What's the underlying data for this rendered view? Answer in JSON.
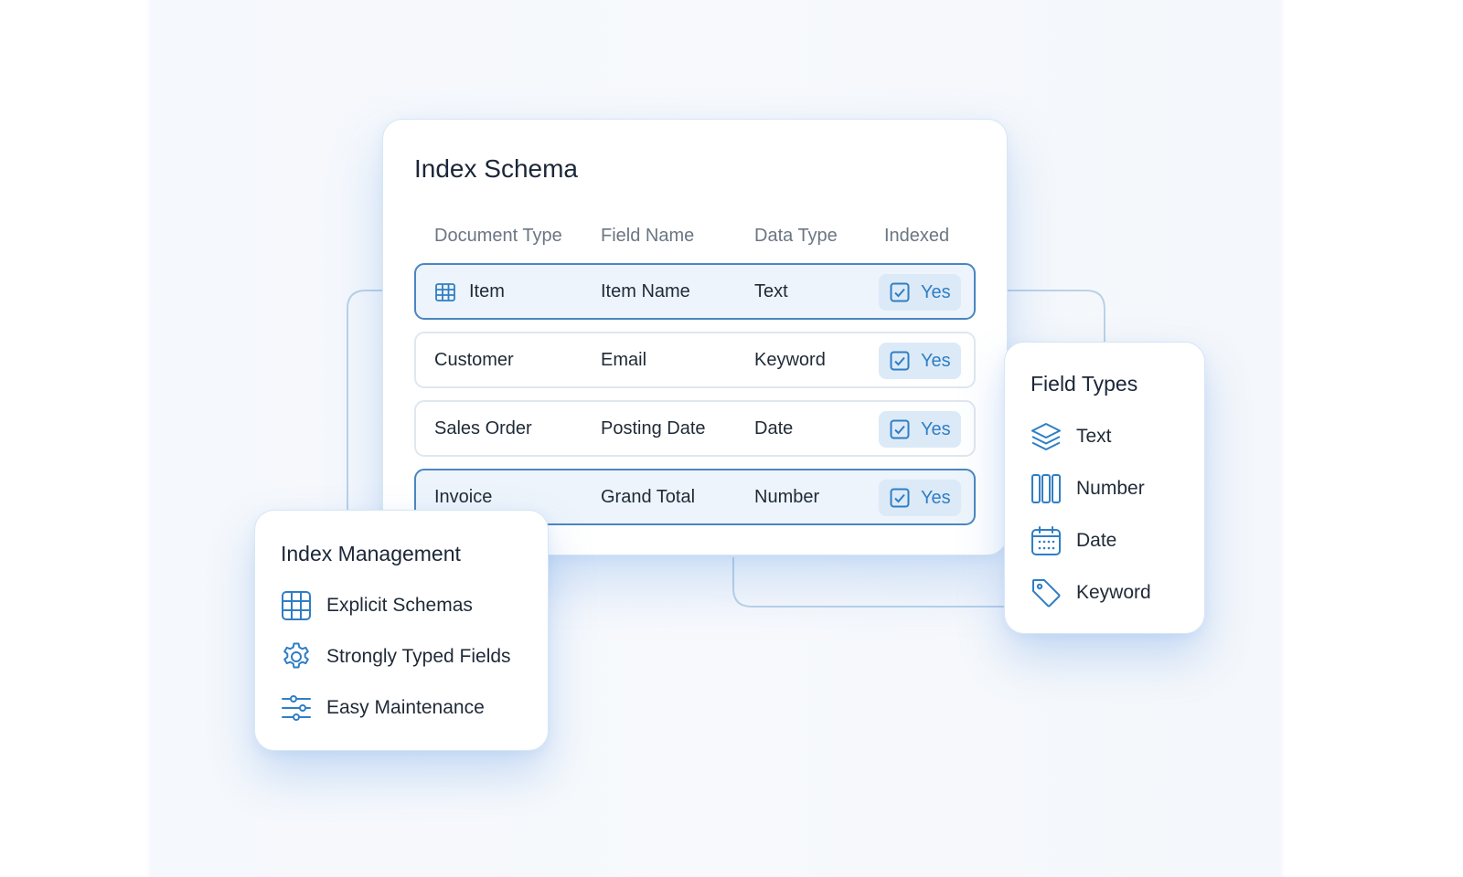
{
  "schema": {
    "title": "Index Schema",
    "columns": [
      "Document Type",
      "Field Name",
      "Data Type",
      "Indexed"
    ],
    "rows": [
      {
        "document_type": "Item",
        "field_name": "Item Name",
        "data_type": "Text",
        "indexed": "Yes",
        "icon": "table-icon",
        "highlighted": true
      },
      {
        "document_type": "Customer",
        "field_name": "Email",
        "data_type": "Keyword",
        "indexed": "Yes",
        "highlighted": false
      },
      {
        "document_type": "Sales Order",
        "field_name": "Posting Date",
        "data_type": "Date",
        "indexed": "Yes",
        "highlighted": false
      },
      {
        "document_type": "Invoice",
        "field_name": "Grand Total",
        "data_type": "Number",
        "indexed": "Yes",
        "highlighted": true
      }
    ]
  },
  "management": {
    "title": "Index Management",
    "items": [
      {
        "label": "Explicit Schemas",
        "icon": "table-icon"
      },
      {
        "label": "Strongly Typed Fields",
        "icon": "gear-icon"
      },
      {
        "label": "Easy Maintenance",
        "icon": "sliders-icon"
      }
    ]
  },
  "field_types": {
    "title": "Field Types",
    "items": [
      {
        "label": "Text",
        "icon": "layers-icon"
      },
      {
        "label": "Number",
        "icon": "columns-icon"
      },
      {
        "label": "Date",
        "icon": "calendar-icon"
      },
      {
        "label": "Keyword",
        "icon": "tag-icon"
      }
    ]
  },
  "colors": {
    "accent": "#2f7ec4",
    "row_highlight_border": "#4b86c0",
    "badge_background": "#dceaf8",
    "connector": "#b6d0ea"
  }
}
